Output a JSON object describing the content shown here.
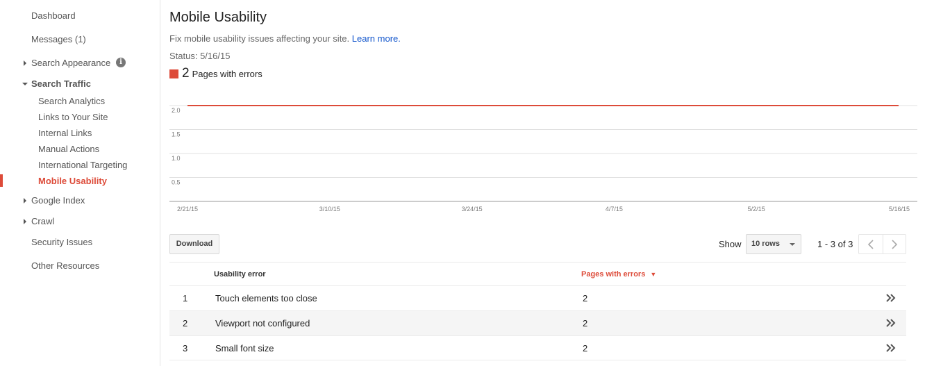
{
  "sidebar": {
    "dashboard": "Dashboard",
    "messages": "Messages (1)",
    "search_appearance": "Search Appearance",
    "search_traffic": "Search Traffic",
    "search_traffic_items": [
      "Search Analytics",
      "Links to Your Site",
      "Internal Links",
      "Manual Actions",
      "International Targeting",
      "Mobile Usability"
    ],
    "google_index": "Google Index",
    "crawl": "Crawl",
    "security_issues": "Security Issues",
    "other_resources": "Other Resources",
    "info_icon_glyph": "i"
  },
  "page": {
    "title": "Mobile Usability",
    "subtitle": "Fix mobile usability issues affecting your site.",
    "learn_more": "Learn more.",
    "status": "Status: 5/16/15",
    "legend_count": "2",
    "legend_label": "Pages with errors",
    "accent_color": "#dd4b39"
  },
  "chart_data": {
    "type": "line",
    "x": [
      "2/21/15",
      "3/10/15",
      "3/24/15",
      "4/7/15",
      "5/2/15",
      "5/16/15"
    ],
    "x_tick_labels": [
      "2/21/15",
      "3/10/15",
      "3/24/15",
      "4/7/15",
      "5/2/15",
      "5/16/15"
    ],
    "y_tick_labels": [
      "2.0",
      "1.5",
      "1.0",
      "0.5"
    ],
    "y_ticks": [
      2.0,
      1.5,
      1.0,
      0.5
    ],
    "ylim": [
      0,
      2.0
    ],
    "grid": true,
    "series": [
      {
        "name": "Pages with errors",
        "color": "#dd4b39",
        "values": [
          2,
          2,
          2,
          2,
          2,
          2
        ]
      }
    ]
  },
  "toolbar": {
    "download": "Download",
    "show": "Show",
    "rows_selected": "10 rows",
    "range": "1 - 3 of 3"
  },
  "table": {
    "headers": {
      "name": "Usability error",
      "pages": "Pages with errors",
      "sort_glyph": "▼"
    },
    "rows": [
      {
        "num": "1",
        "name": "Touch elements too close",
        "pages": "2"
      },
      {
        "num": "2",
        "name": "Viewport not configured",
        "pages": "2"
      },
      {
        "num": "3",
        "name": "Small font size",
        "pages": "2"
      }
    ]
  }
}
